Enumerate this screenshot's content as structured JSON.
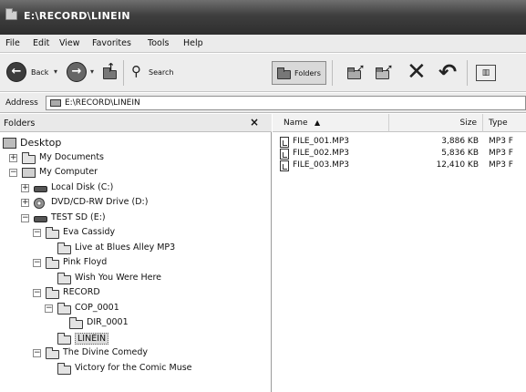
{
  "window": {
    "title": "E:\\RECORD\\LINEIN"
  },
  "menu": [
    "File",
    "Edit",
    "View",
    "Favorites",
    "Tools",
    "Help"
  ],
  "toolbar": {
    "back_label": "Back",
    "search_label": "Search",
    "folders_label": "Folders",
    "back_icon": "back-arrow-icon",
    "forward_icon": "forward-arrow-icon",
    "up_icon": "up-folder-icon",
    "search_icon": "magnifier-icon",
    "move_icon": "move-to-icon",
    "copy_icon": "copy-to-icon",
    "delete_icon": "delete-x-icon",
    "undo_icon": "undo-icon",
    "views_icon": "views-icon"
  },
  "address": {
    "label": "Address",
    "value": "E:\\RECORD\\LINEIN"
  },
  "folders_pane": {
    "title": "Folders",
    "close_icon": "close-icon"
  },
  "tree": [
    {
      "label": "Desktop",
      "icon": "desktop-icon",
      "expander": ""
    },
    {
      "label": "My Documents",
      "icon": "folder-icon",
      "expander": "+"
    },
    {
      "label": "My Computer",
      "icon": "computer-icon",
      "expander": "−"
    },
    {
      "label": "Local Disk (C:)",
      "icon": "disk-icon",
      "expander": "+"
    },
    {
      "label": "DVD/CD-RW Drive (D:)",
      "icon": "dvd-icon",
      "expander": "+"
    },
    {
      "label": "TEST SD (E:)",
      "icon": "disk-icon",
      "expander": "−"
    },
    {
      "label": "Eva Cassidy",
      "icon": "folder-icon",
      "expander": "−"
    },
    {
      "label": "Live at Blues Alley MP3",
      "icon": "folder-icon",
      "expander": ""
    },
    {
      "label": "Pink Floyd",
      "icon": "folder-icon",
      "expander": "−"
    },
    {
      "label": "Wish You Were Here",
      "icon": "folder-icon",
      "expander": ""
    },
    {
      "label": "RECORD",
      "icon": "folder-icon",
      "expander": "−"
    },
    {
      "label": "COP_0001",
      "icon": "folder-icon",
      "expander": "−"
    },
    {
      "label": "DIR_0001",
      "icon": "folder-icon",
      "expander": ""
    },
    {
      "label": "LINEIN",
      "icon": "folder-icon",
      "expander": "",
      "selected": true
    },
    {
      "label": "The Divine Comedy",
      "icon": "folder-icon",
      "expander": "−"
    },
    {
      "label": "Victory for the Comic Muse",
      "icon": "folder-icon",
      "expander": ""
    }
  ],
  "files": {
    "columns": {
      "name": "Name",
      "size": "Size",
      "type": "Type"
    },
    "sort_indicator": "▲",
    "rows": [
      {
        "name": "FILE_001.MP3",
        "size": "3,886 KB",
        "type": "MP3 F"
      },
      {
        "name": "FILE_002.MP3",
        "size": "5,836 KB",
        "type": "MP3 F"
      },
      {
        "name": "FILE_003.MP3",
        "size": "12,410 KB",
        "type": "MP3 F"
      }
    ]
  }
}
